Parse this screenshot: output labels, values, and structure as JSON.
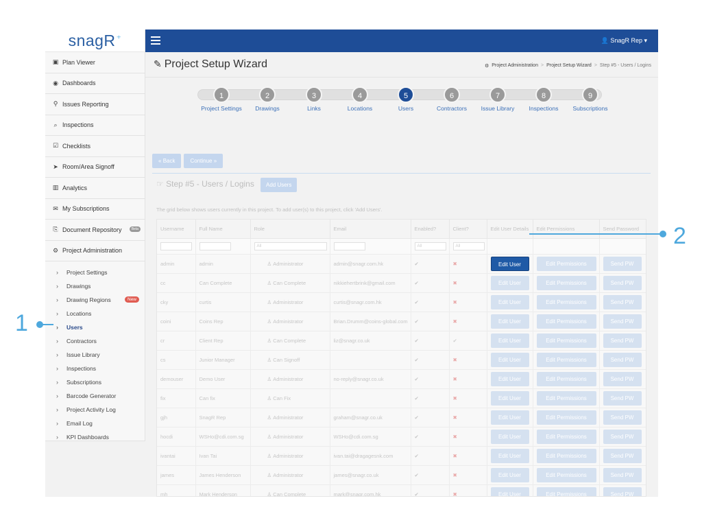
{
  "logo": {
    "text": "snagR"
  },
  "sidebar": {
    "items": [
      {
        "label": "Plan Viewer",
        "icon": "image-icon"
      },
      {
        "label": "Dashboards",
        "icon": "dashboard-icon"
      },
      {
        "label": "Issues Reporting",
        "icon": "map-pin-icon"
      },
      {
        "label": "Inspections",
        "icon": "search-icon"
      },
      {
        "label": "Checklists",
        "icon": "checklist-icon"
      },
      {
        "label": "Room/Area Signoff",
        "icon": "send-icon"
      },
      {
        "label": "Analytics",
        "icon": "chart-icon"
      },
      {
        "label": "My Subscriptions",
        "icon": "mail-icon"
      },
      {
        "label": "Document Repository",
        "icon": "document-icon",
        "badge": "Beta"
      },
      {
        "label": "Project Administration",
        "icon": "gears-icon"
      }
    ],
    "sub_items": [
      {
        "label": "Project Settings"
      },
      {
        "label": "Drawings"
      },
      {
        "label": "Drawing Regions",
        "badge": "New"
      },
      {
        "label": "Locations"
      },
      {
        "label": "Users",
        "active": true
      },
      {
        "label": "Contractors"
      },
      {
        "label": "Issue Library"
      },
      {
        "label": "Inspections"
      },
      {
        "label": "Subscriptions"
      },
      {
        "label": "Barcode Generator"
      },
      {
        "label": "Project Activity Log"
      },
      {
        "label": "Email Log"
      },
      {
        "label": "KPI Dashboards"
      }
    ]
  },
  "topbar": {
    "user": "SnagR Rep"
  },
  "header": {
    "title": "Project Setup Wizard",
    "breadcrumb": [
      "Project Administration",
      "Project Setup Wizard",
      "Step #5 - Users / Logins"
    ]
  },
  "wizard": {
    "steps": [
      {
        "num": "1",
        "label": "Project Settings"
      },
      {
        "num": "2",
        "label": "Drawings"
      },
      {
        "num": "3",
        "label": "Links"
      },
      {
        "num": "4",
        "label": "Locations"
      },
      {
        "num": "5",
        "label": "Users",
        "active": true
      },
      {
        "num": "6",
        "label": "Contractors"
      },
      {
        "num": "7",
        "label": "Issue Library"
      },
      {
        "num": "8",
        "label": "Inspections"
      },
      {
        "num": "9",
        "label": "Subscriptions"
      }
    ],
    "back_label": "Back",
    "continue_label": "Continue"
  },
  "step": {
    "title": "Step #5 - Users / Logins",
    "add_users_label": "Add Users",
    "help_text": "The grid below shows users currently in this project. To add user(s) to this project, click 'Add Users'."
  },
  "grid": {
    "headers": [
      "Username",
      "Full Name",
      "Role",
      "Email",
      "Enabled?",
      "Client?",
      "Edit User Details",
      "Edit Permissions",
      "Send Password"
    ],
    "filter_all": "All",
    "edit_label": "Edit User",
    "perm_label": "Edit Permissions",
    "pw_label": "Send PW",
    "rows": [
      {
        "username": "admin",
        "fullname": "admin",
        "role": "Administrator",
        "email": "admin@snagr.com.hk",
        "enabled": true,
        "client": false
      },
      {
        "username": "cc",
        "fullname": "Can Complete",
        "role": "Can Complete",
        "email": "nikkiehertbrink@gmail.com",
        "enabled": true,
        "client": false
      },
      {
        "username": "cky",
        "fullname": "curtis",
        "role": "Administrator",
        "email": "curtis@snagr.com.hk",
        "enabled": true,
        "client": false
      },
      {
        "username": "coini",
        "fullname": "Coins Rep",
        "role": "Administrator",
        "email": "Brian.Drumm@coins-global.com",
        "enabled": true,
        "client": false
      },
      {
        "username": "cr",
        "fullname": "Client Rep",
        "role": "Can Complete",
        "email": "liz@snagr.co.uk",
        "enabled": true,
        "client": true
      },
      {
        "username": "cs",
        "fullname": "Junior Manager",
        "role": "Can Signoff",
        "email": "",
        "enabled": true,
        "client": false
      },
      {
        "username": "demouser",
        "fullname": "Demo User",
        "role": "Administrator",
        "email": "no-reply@snagr.co.uk",
        "enabled": true,
        "client": false
      },
      {
        "username": "fix",
        "fullname": "Can fix",
        "role": "Can Fix",
        "email": "",
        "enabled": true,
        "client": false
      },
      {
        "username": "gjh",
        "fullname": "SnagR Rep",
        "role": "Administrator",
        "email": "graham@snagr.co.uk",
        "enabled": true,
        "client": false
      },
      {
        "username": "hocdi",
        "fullname": "WSHo@cdi.com.sg",
        "role": "Administrator",
        "email": "WSHo@cdi.com.sg",
        "enabled": true,
        "client": false
      },
      {
        "username": "ivantai",
        "fullname": "Ivan Tai",
        "role": "Administrator",
        "email": "ivan.tai@dragagesnk.com",
        "enabled": true,
        "client": false
      },
      {
        "username": "james",
        "fullname": "James Henderson",
        "role": "Administrator",
        "email": "james@snagr.co.uk",
        "enabled": true,
        "client": false
      },
      {
        "username": "mh",
        "fullname": "Mark Henderson",
        "role": "Can Complete",
        "email": "mark@snagr.com.hk",
        "enabled": true,
        "client": false
      },
      {
        "username": "michaelc",
        "fullname": "Michael Chan",
        "role": "Administrator",
        "email": "michael.chan@snagr.com.hk",
        "enabled": true,
        "client": false
      },
      {
        "username": "",
        "fullname": "",
        "role": "",
        "email": "",
        "enabled": true,
        "client": false
      }
    ]
  },
  "annotations": {
    "one": "1",
    "two": "2"
  },
  "colors": {
    "brand": "#1e4d97",
    "accent": "#4ea8dd",
    "new_badge": "#e05c52"
  }
}
